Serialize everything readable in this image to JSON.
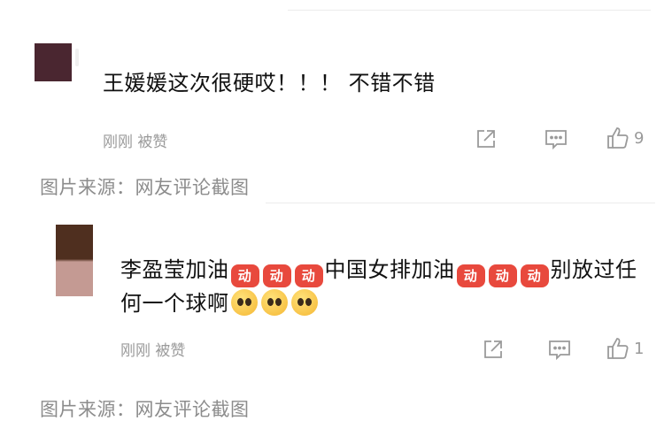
{
  "comments": [
    {
      "text": "王媛媛这次很硬哎！！！ 不错不错",
      "meta": "刚刚 被赞",
      "like_count": "9"
    },
    {
      "text_a": "李盈莹加油",
      "text_b": "中国女排加油",
      "text_c": "别放过任何一个球啊",
      "meta": "刚刚 被赞",
      "like_count": "1",
      "fire_emoji_label": "动"
    }
  ],
  "captions": [
    "图片来源：网友评论截图",
    "图片来源：网友评论截图"
  ],
  "icons": {
    "share": "share-icon",
    "comment": "comment-icon",
    "like": "thumbs-up-icon",
    "fire": "fire-emoji-icon",
    "pleading": "pleading-face-emoji-icon"
  },
  "colors": {
    "meta": "#9a9a9a",
    "fire_emoji": "#e8493d",
    "caption": "#8c8c8c"
  }
}
